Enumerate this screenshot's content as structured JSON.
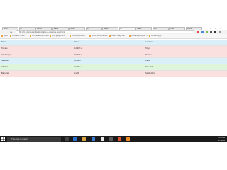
{
  "browser": {
    "tabs": [
      {
        "label": "Mobi",
        "active": false
      },
      {
        "label": "M",
        "active": false
      },
      {
        "label": "AutoC",
        "active": false
      },
      {
        "label": "Sales",
        "active": false
      },
      {
        "label": "Sales",
        "active": false
      },
      {
        "label": "M",
        "active": false
      },
      {
        "label": "Sales",
        "active": false
      },
      {
        "label": "M",
        "active": true
      },
      {
        "label": "SaaS",
        "active": false
      },
      {
        "label": "Acc",
        "active": false
      },
      {
        "label": "Trial",
        "active": false
      },
      {
        "label": "Sales",
        "active": false
      }
    ],
    "url": "file:///C:/Users/user/Desktop/table-2-row-style-fixed.html",
    "bookmarks": [
      "Apps",
      "Formatter online",
      "Free javascript obfuscator",
      "Free google fonts",
      "Lorem ipsum text",
      "Lorem font generator",
      "Online image tool",
      "Formatting Angular Tips",
      "Formatting Ip"
    ]
  },
  "table": {
    "headers": [
      "Name",
      "Value",
      "Location"
    ],
    "rows": [
      {
        "name": "Tomato",
        "value": "12,347 s",
        "location": "Tokyo",
        "color": "#fae0df"
      },
      {
        "name": "Hamburger",
        "value": "10,234 s",
        "location": "Toronto",
        "color": "#fae0df"
      },
      {
        "name": "Sandwich",
        "value": "8,902 s",
        "location": "Paris",
        "color": "#dbeff9"
      },
      {
        "name": "Chicken",
        "value": "7,451 s",
        "location": "New York",
        "color": "#def5dc"
      },
      {
        "name": "Baby cat",
        "value": "2,201",
        "location": "South Africa",
        "color": "#fae0df"
      }
    ],
    "header_color": "#dbeff9"
  },
  "taskbar": {
    "search_placeholder": "Type here to search",
    "time": "4:35 PM",
    "date": "3/7/2024"
  }
}
